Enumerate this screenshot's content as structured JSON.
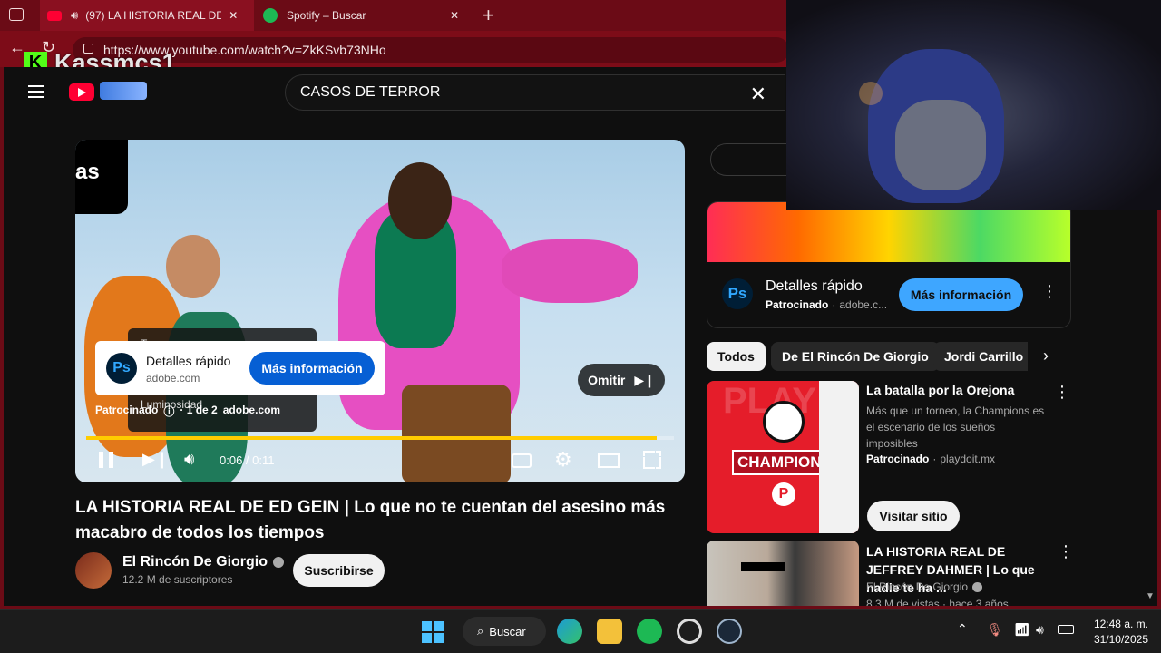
{
  "browser": {
    "tabs": [
      {
        "label": "(97) LA HISTORIA REAL DE ED",
        "close": "✕"
      },
      {
        "label": "Spotify – Buscar",
        "close": "✕"
      }
    ],
    "new_tab": "+",
    "url": "https://www.youtube.com/watch?v=ZkKSvb73NHo"
  },
  "overlay": {
    "streamer_name": "Kassmcs1",
    "logo_letter": "K"
  },
  "youtube": {
    "search_value": "CASOS DE TERROR",
    "video": {
      "corner_text": "as",
      "ad_card": {
        "title": "Detalles rápido",
        "domain": "adobe.com",
        "button": "Más información",
        "logo": "Ps"
      },
      "menu_labels": [
        "Tono",
        "Luminosidad"
      ],
      "sponsor_line": "Patrocinado",
      "ad_count": "· 1 de 2",
      "ad_domain": "adobe.com",
      "skip_label": "Omitir",
      "time": "0:06 / 0:11",
      "progress": 0.97
    },
    "title": "LA HISTORIA REAL DE ED GEIN | Lo que no te cuentan del asesino más macabro de todos los tiempos",
    "channel": {
      "name": "El Rincón De Giorgio",
      "subs": "12.2 M de suscriptores",
      "subscribe": "Suscribirse"
    },
    "side_ad": {
      "title": "Detalles rápido",
      "sponsored": "Patrocinado",
      "domain": "adobe.c...",
      "button": "Más información",
      "logo": "Ps"
    },
    "chips": [
      "Todos",
      "De El Rincón De Giorgio",
      "Jordi Carrillo"
    ],
    "rec1": {
      "title": "La batalla por la Orejona",
      "desc": "Más que un torneo, la Champions es el escenario de los sueños imposibles",
      "sponsored": "Patrocinado",
      "domain": "playdoit.mx",
      "button": "Visitar sitio",
      "thumb_text": "CHAMPIONS",
      "thumb_letter": "P",
      "bg_text": "PLAY"
    },
    "rec2": {
      "title": "LA HISTORIA REAL DE JEFFREY DAHMER | Lo que nadie te ha ...",
      "channel": "El Rincón De Giorgio",
      "meta": "8.3 M de vistas · hace 3 años"
    }
  },
  "taskbar": {
    "search_label": "Buscar",
    "time": "12:48 a. m.",
    "date": "31/10/2025"
  },
  "colors": {
    "accent": "#3ea6ff",
    "ad_yellow": "#ffcc00",
    "browser_red": "#7d0c18",
    "spotify": "#1db954"
  }
}
